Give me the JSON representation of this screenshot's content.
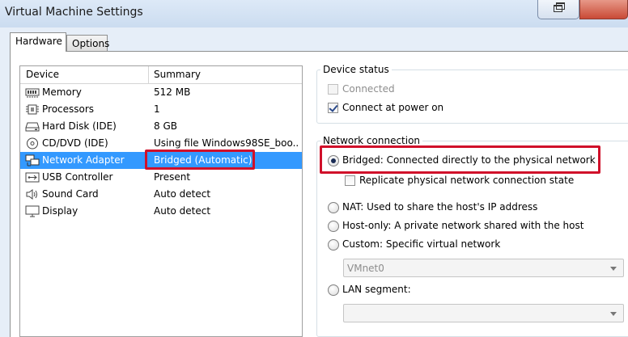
{
  "window": {
    "title": "Virtual Machine Settings"
  },
  "tabs": [
    {
      "label": "Hardware",
      "active": true
    },
    {
      "label": "Options",
      "active": false
    }
  ],
  "device_list": {
    "headers": {
      "device": "Device",
      "summary": "Summary"
    },
    "rows": [
      {
        "icon": "memory-icon",
        "device": "Memory",
        "summary": "512 MB"
      },
      {
        "icon": "processor-icon",
        "device": "Processors",
        "summary": "1"
      },
      {
        "icon": "hard-disk-icon",
        "device": "Hard Disk (IDE)",
        "summary": "8 GB"
      },
      {
        "icon": "cd-dvd-icon",
        "device": "CD/DVD (IDE)",
        "summary": "Using file Windows98SE_boo..."
      },
      {
        "icon": "network-adapter-icon",
        "device": "Network Adapter",
        "summary": "Bridged (Automatic)",
        "selected": true
      },
      {
        "icon": "usb-icon",
        "device": "USB Controller",
        "summary": "Present"
      },
      {
        "icon": "sound-icon",
        "device": "Sound Card",
        "summary": "Auto detect"
      },
      {
        "icon": "display-icon",
        "device": "Display",
        "summary": "Auto detect"
      }
    ]
  },
  "device_status": {
    "label": "Device status",
    "connected": {
      "label": "Connected",
      "checked": false,
      "enabled": false
    },
    "connect_at_power_on": {
      "label": "Connect at power on",
      "checked": true,
      "enabled": true
    }
  },
  "network_connection": {
    "label": "Network connection",
    "bridged": {
      "label": "Bridged: Connected directly to the physical network",
      "checked": true
    },
    "replicate": {
      "label": "Replicate physical network connection state",
      "checked": false
    },
    "nat": {
      "label": "NAT: Used to share the host's IP address",
      "checked": false
    },
    "host_only": {
      "label": "Host-only: A private network shared with the host",
      "checked": false
    },
    "custom": {
      "label": "Custom: Specific virtual network",
      "checked": false
    },
    "custom_select": {
      "value": "VMnet0",
      "enabled": false
    },
    "lan_segment": {
      "label": "LAN segment:",
      "checked": false
    },
    "lan_select": {
      "value": "",
      "enabled": false
    }
  },
  "colors": {
    "selection": "#3399ff",
    "highlight_annotation": "#d0102a"
  }
}
